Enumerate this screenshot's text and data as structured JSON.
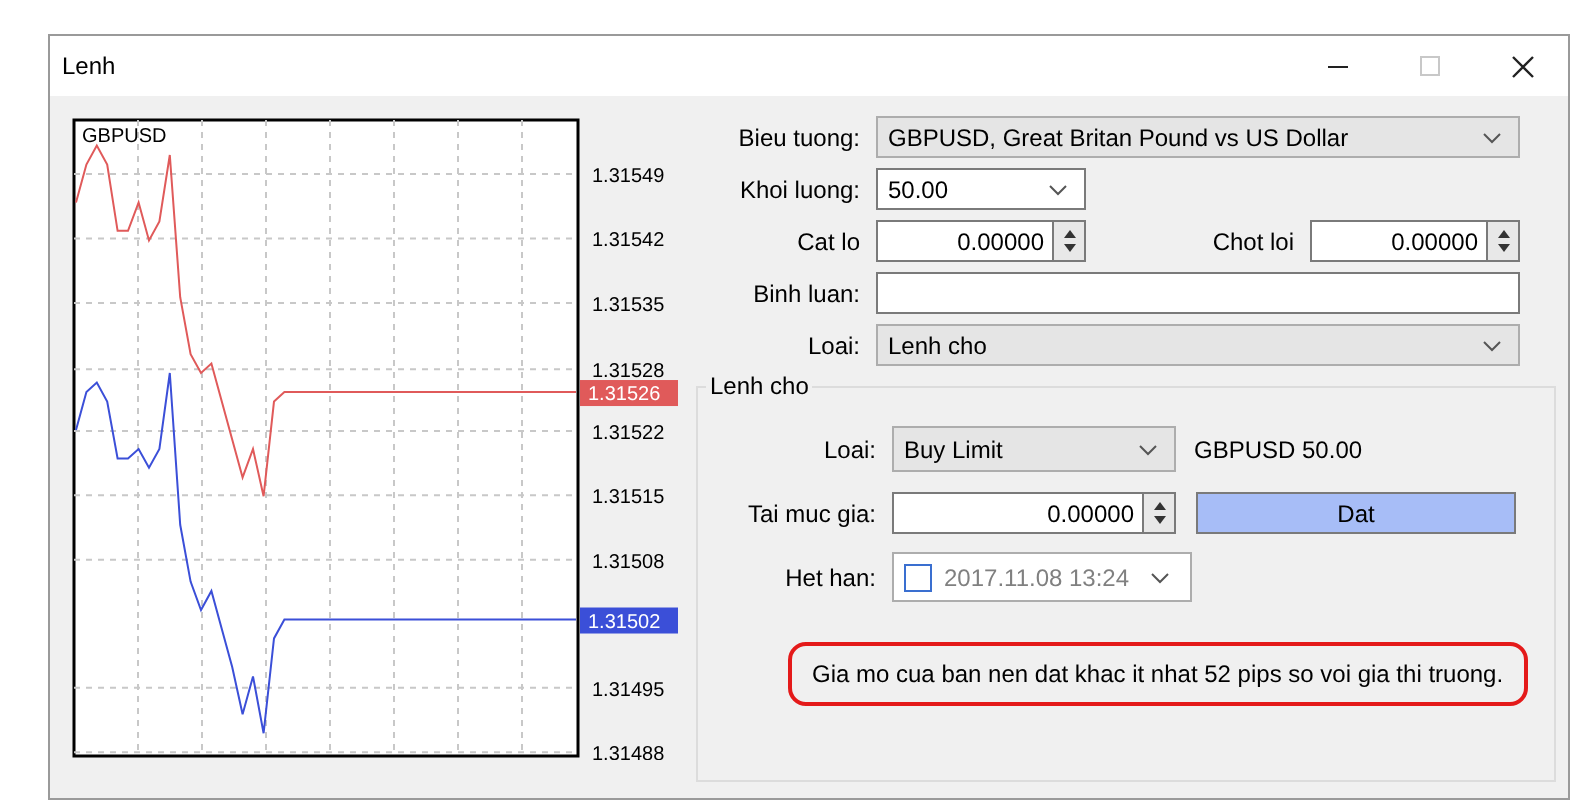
{
  "window": {
    "title": "Lenh",
    "controls": [
      {
        "kind": "minimize",
        "disabled": false
      },
      {
        "kind": "maximize",
        "disabled": true
      },
      {
        "kind": "close",
        "disabled": false
      }
    ]
  },
  "chart": {
    "symbol": "GBPUSD",
    "chart_data": {
      "type": "line",
      "grid": true,
      "categories": [
        null,
        null,
        null,
        null,
        null,
        null,
        null,
        null,
        null,
        null,
        null,
        null,
        null,
        null,
        null,
        null,
        null,
        null,
        null,
        null,
        null,
        null,
        null,
        null,
        null,
        null,
        null,
        null,
        null,
        null,
        null,
        null,
        null,
        null,
        null,
        null,
        null,
        null,
        null,
        null,
        null,
        null,
        null,
        null,
        null,
        null,
        null,
        null,
        null
      ],
      "ylim": [
        1.314876,
        1.315547
      ],
      "yticks": [
        {
          "value": 1.31549,
          "label": "1.31549"
        },
        {
          "value": 1.315422,
          "label": "1.31542"
        },
        {
          "value": 1.315354,
          "label": "1.31535"
        },
        {
          "value": 1.315284,
          "label": "1.31528"
        },
        {
          "value": 1.315219,
          "label": "1.31522"
        },
        {
          "value": 1.315151,
          "label": "1.31515"
        },
        {
          "value": 1.315083,
          "label": "1.31508"
        },
        {
          "value": 1.314948,
          "label": "1.31495"
        },
        {
          "value": 1.31488,
          "label": "1.31488"
        }
      ],
      "series": [
        {
          "color": "#e05a5a",
          "values": [
            1.31546,
            1.3155,
            1.31552,
            1.3155,
            1.31543,
            1.31543,
            1.31546,
            1.31542,
            1.31544,
            1.31551,
            1.31536,
            1.3153,
            1.31528,
            1.31529,
            1.31525,
            1.31521,
            1.31517,
            1.3152,
            1.31515,
            1.31525,
            1.31526,
            1.31526,
            1.31526,
            1.31526,
            1.31526,
            1.31526,
            1.31526,
            1.31526,
            1.31526,
            1.31526,
            1.31526,
            1.31526,
            1.31526,
            1.31526,
            1.31526,
            1.31526,
            1.31526,
            1.31526,
            1.31526,
            1.31526,
            1.31526,
            1.31526,
            1.31526,
            1.31526,
            1.31526,
            1.31526,
            1.31526,
            1.31526,
            1.31526
          ]
        },
        {
          "color": "#3b4fd8",
          "values": [
            1.31522,
            1.31526,
            1.31527,
            1.31525,
            1.31519,
            1.31519,
            1.3152,
            1.31518,
            1.3152,
            1.31528,
            1.31512,
            1.31506,
            1.31503,
            1.31505,
            1.31501,
            1.31497,
            1.31492,
            1.31496,
            1.3149,
            1.315,
            1.31502,
            1.31502,
            1.31502,
            1.31502,
            1.31502,
            1.31502,
            1.31502,
            1.31502,
            1.31502,
            1.31502,
            1.31502,
            1.31502,
            1.31502,
            1.31502,
            1.31502,
            1.31502,
            1.31502,
            1.31502,
            1.31502,
            1.31502,
            1.31502,
            1.31502,
            1.31502,
            1.31502,
            1.31502,
            1.31502,
            1.31502,
            1.31502,
            1.31502
          ]
        }
      ]
    },
    "price_tags": [
      {
        "text": "1.31526",
        "color": "#e05a5a"
      },
      {
        "text": "1.31502",
        "color": "#3b4fd8"
      }
    ]
  },
  "form": {
    "rows": [
      {
        "kind": "select",
        "label": "Bieu tuong:",
        "value": "GBPUSD, Great Britan Pound vs US Dollar"
      },
      {
        "kind": "combo",
        "label": "Khoi luong:",
        "value": "50.00"
      },
      {
        "kind": "spin_pair",
        "label": "Cat lo",
        "value": "0.00000",
        "label2": "Chot loi",
        "value2": "0.00000"
      },
      {
        "kind": "text",
        "label": "Binh luan:"
      },
      {
        "kind": "select",
        "label": "Loai:",
        "value": "Lenh cho"
      }
    ]
  },
  "pending": {
    "title": "Lenh cho",
    "type_label": "Loai:",
    "type_value": "Buy Limit",
    "summary": "GBPUSD 50.00",
    "price_label": "Tai muc gia:",
    "price_value": "0.00000",
    "place_button": "Dat",
    "expiry_label": "Het han:",
    "expiry_checked": false,
    "expiry_value": "2017.11.08 13:24",
    "message": "Gia mo cua ban nen dat khac it nhat 52 pips so voi gia thi truong."
  }
}
